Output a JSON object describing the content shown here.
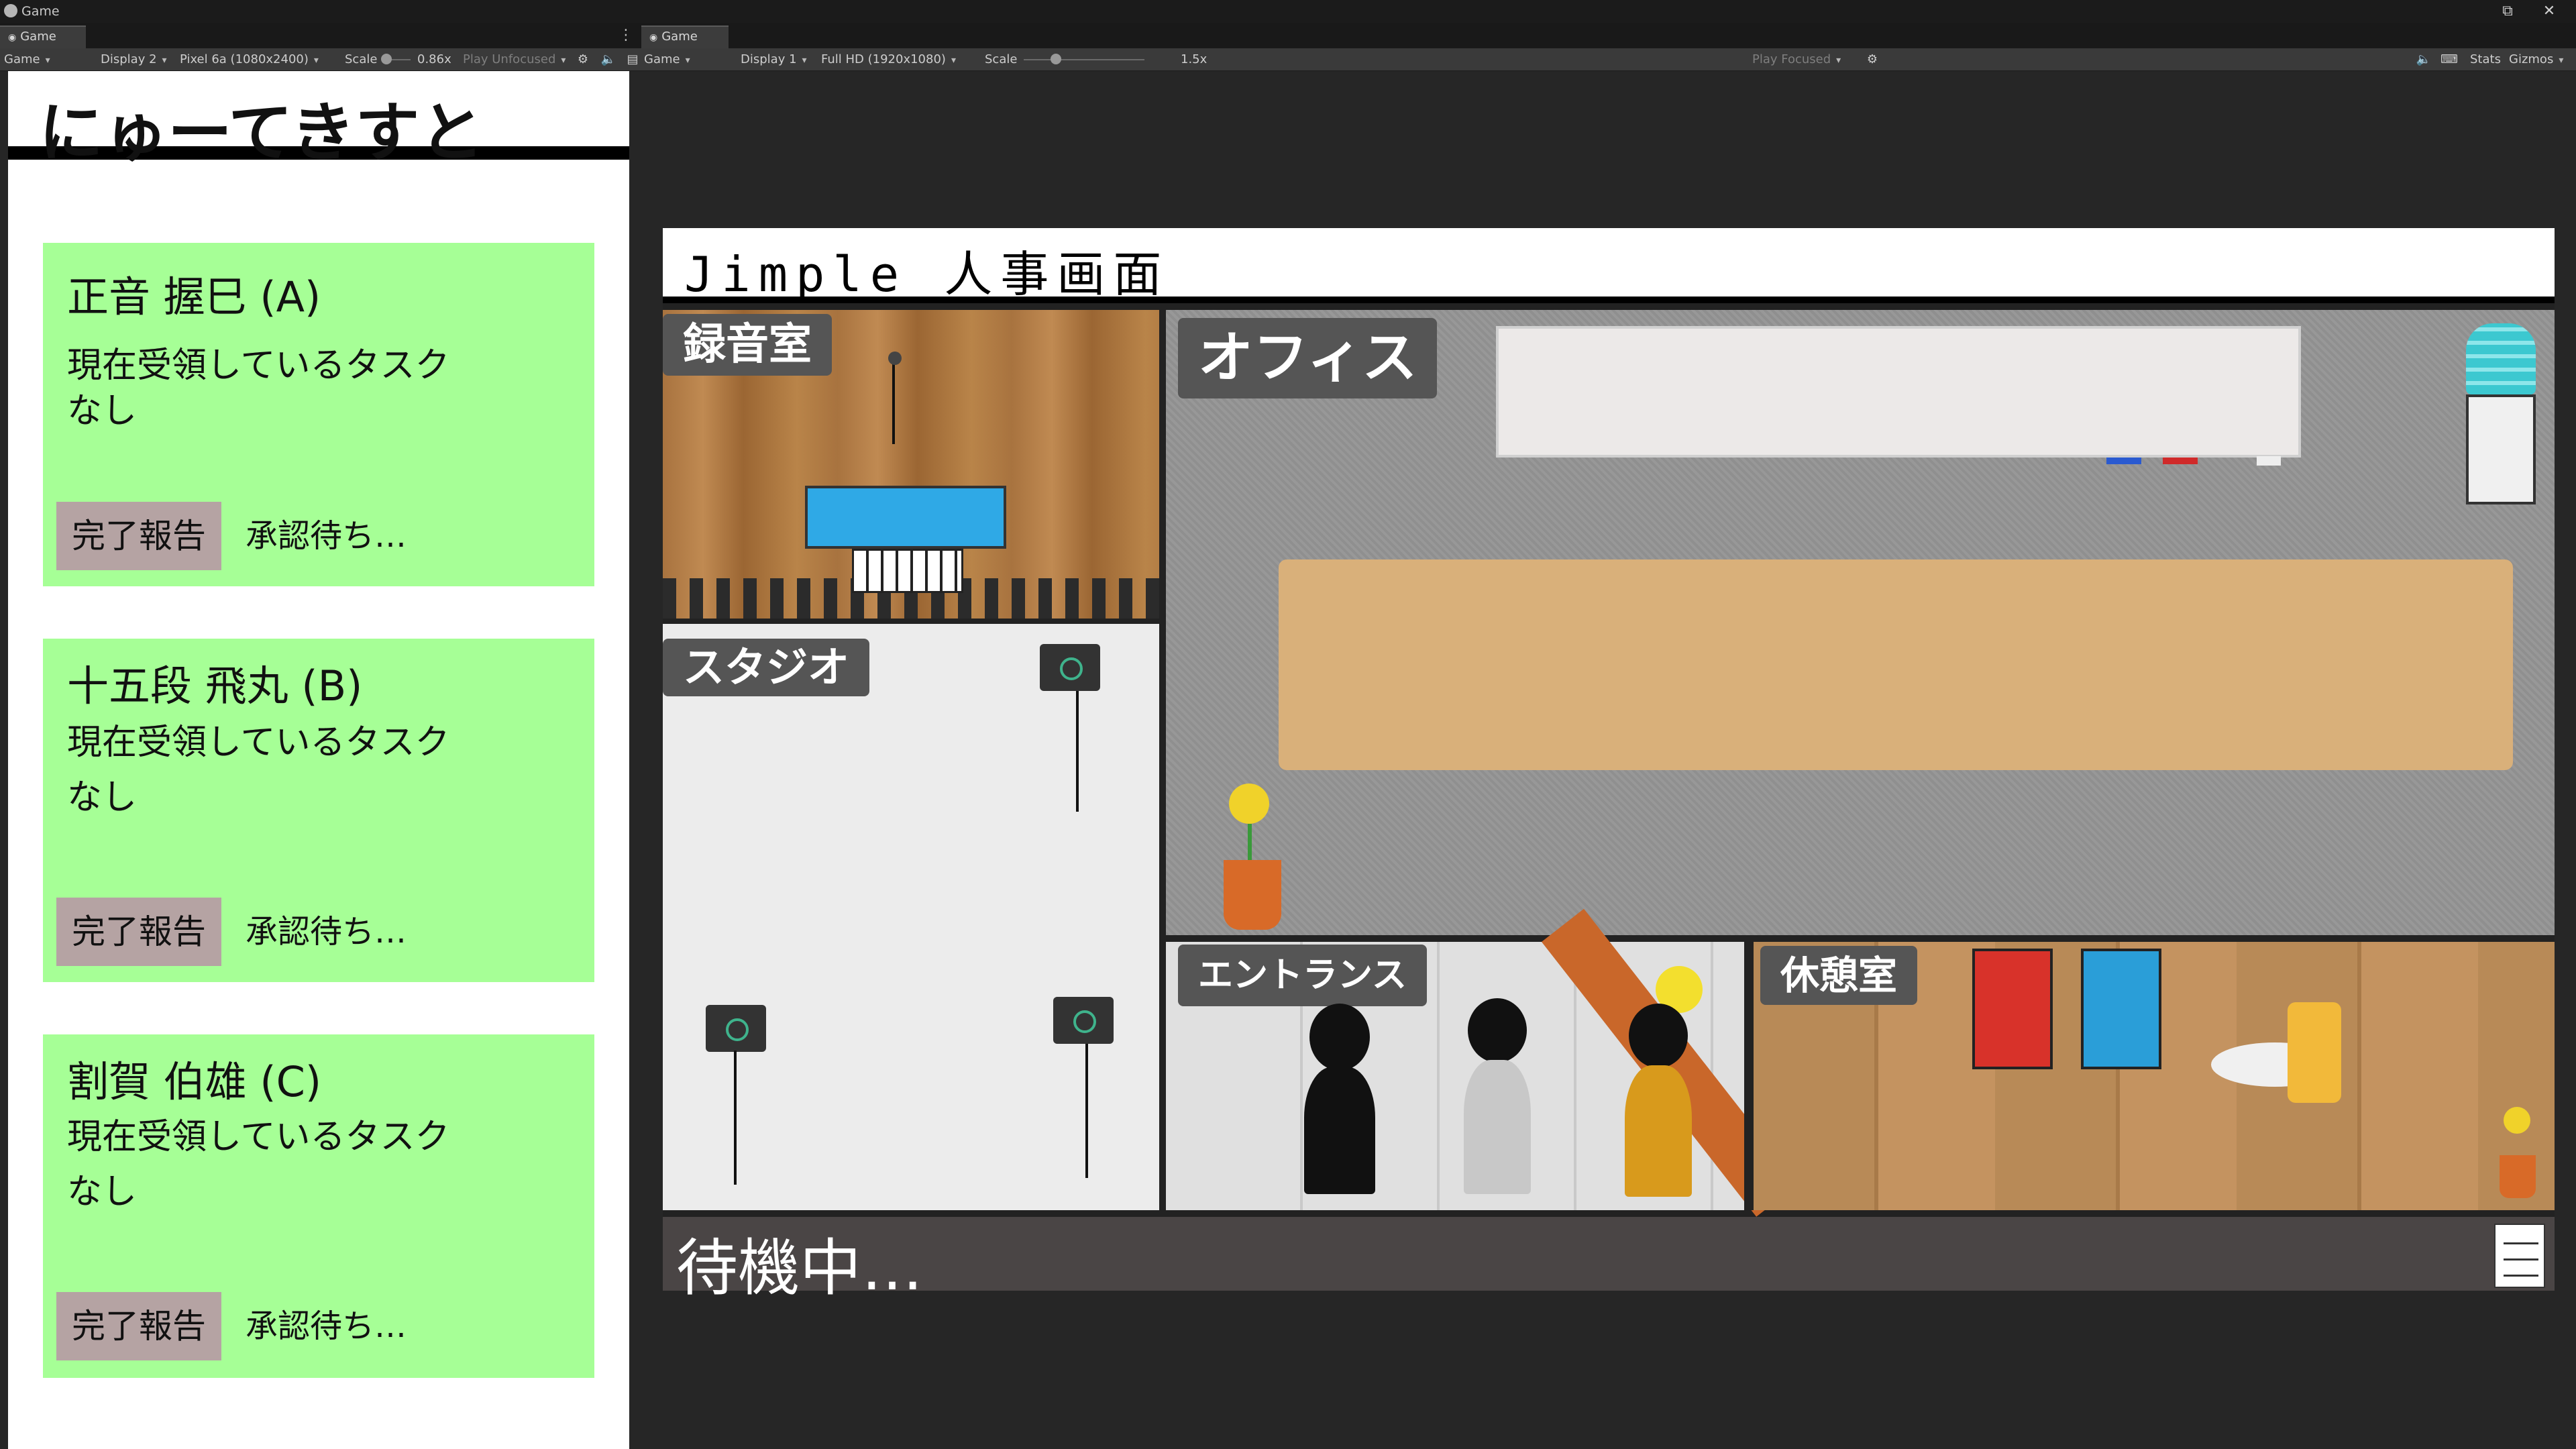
{
  "window": {
    "title": "Game"
  },
  "tabs": [
    {
      "label": "Game"
    },
    {
      "label": "Game"
    }
  ],
  "left_toolbar": {
    "mode": "Game",
    "display": "Display 2",
    "resolution": "Pixel 6a (1080x2400)",
    "scale_label": "Scale",
    "scale_value": "0.86x",
    "play_mode": "Play Unfocused"
  },
  "right_toolbar": {
    "mode": "Game",
    "display": "Display 1",
    "resolution": "Full HD (1920x1080)",
    "scale_label": "Scale",
    "scale_value": "1.5x",
    "play_mode": "Play Focused",
    "stats": "Stats",
    "gizmos": "Gizmos"
  },
  "phone": {
    "title": "にゅーてきすと",
    "cards": [
      {
        "name": "正音 握巳 (A)",
        "task_label": "現在受領しているタスク",
        "task_value": "なし",
        "button": "完了報告",
        "status": "承認待ち…"
      },
      {
        "name": "十五段 飛丸 (B)",
        "task_label": "現在受領しているタスク",
        "task_value": "なし",
        "button": "完了報告",
        "status": "承認待ち…"
      },
      {
        "name": "割賀 伯雄 (C)",
        "task_label": "現在受領しているタスク",
        "task_value": "なし",
        "button": "完了報告",
        "status": "承認待ち…"
      }
    ]
  },
  "game": {
    "header": "Jimple 人事画面",
    "rooms": {
      "recording": "録音室",
      "studio": "スタジオ",
      "office": "オフィス",
      "entrance": "エントランス",
      "lounge": "休憩室"
    },
    "status": "待機中…"
  },
  "colors": {
    "card_bg": "#a6ff96",
    "button_bg": "#b5a3a3",
    "room_label_bg": "#555555",
    "status_bar_bg": "#4a4545"
  }
}
